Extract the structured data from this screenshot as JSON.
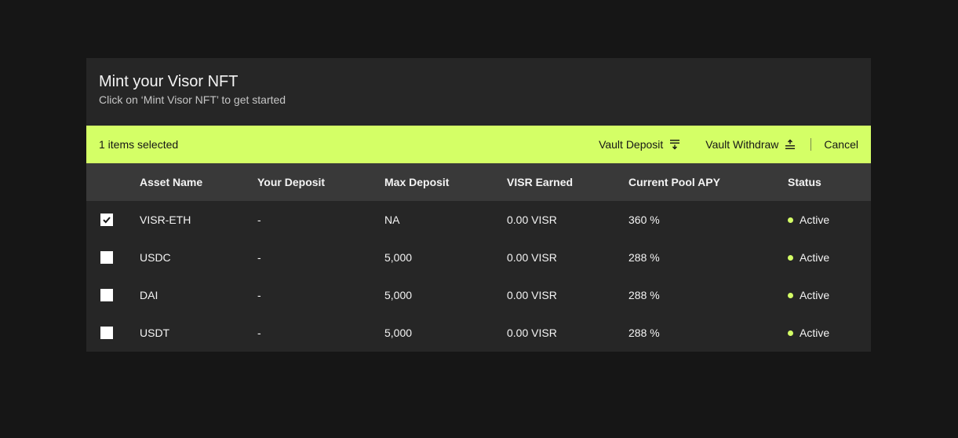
{
  "header": {
    "title": "Mint your Visor NFT",
    "subtitle": "Click on ‘Mint Visor NFT’ to get started"
  },
  "batch": {
    "selected_text": "1 items selected",
    "deposit_label": "Vault Deposit",
    "deposit_icon": "download-icon",
    "withdraw_label": "Vault Withdraw",
    "withdraw_icon": "upload-icon",
    "cancel_label": "Cancel"
  },
  "colors": {
    "accent": "#d4ff66",
    "panel": "#262626",
    "header_row": "#393939",
    "page_bg": "#161616"
  },
  "table": {
    "headers": [
      "Asset Name",
      "Your Deposit",
      "Max Deposit",
      "VISR Earned",
      "Current Pool APY",
      "Status"
    ],
    "rows": [
      {
        "checked": true,
        "asset": "VISR-ETH",
        "deposit": "-",
        "max": "NA",
        "earned": "0.00 VISR",
        "apy": "360 %",
        "status": "Active"
      },
      {
        "checked": false,
        "asset": "USDC",
        "deposit": "-",
        "max": "5,000",
        "earned": "0.00 VISR",
        "apy": "288 %",
        "status": "Active"
      },
      {
        "checked": false,
        "asset": "DAI",
        "deposit": "-",
        "max": "5,000",
        "earned": "0.00 VISR",
        "apy": "288 %",
        "status": "Active"
      },
      {
        "checked": false,
        "asset": "USDT",
        "deposit": "-",
        "max": "5,000",
        "earned": "0.00 VISR",
        "apy": "288 %",
        "status": "Active"
      }
    ]
  }
}
